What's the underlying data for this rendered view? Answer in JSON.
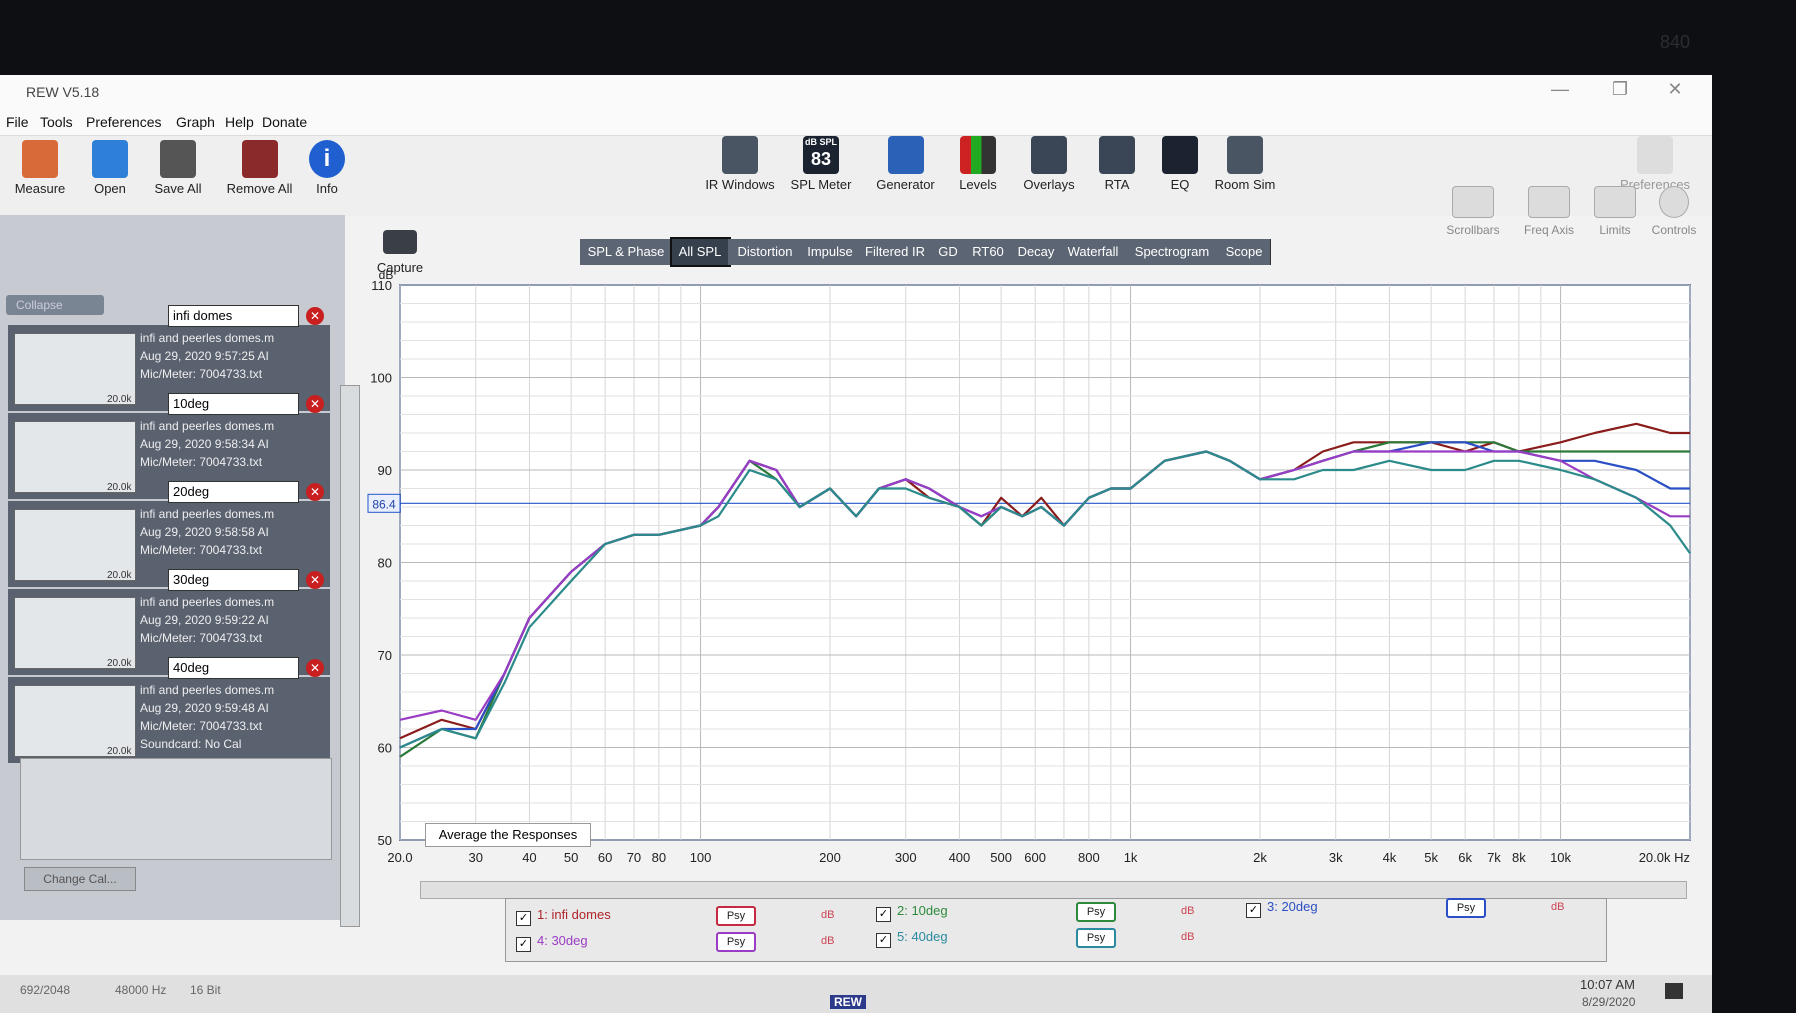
{
  "window": {
    "title": "REW V5.18",
    "controls": [
      "—",
      "❐",
      "✕"
    ]
  },
  "menu": [
    "File",
    "Tools",
    "Preferences",
    "Graph",
    "Help",
    "Donate"
  ],
  "toolbar_left": [
    {
      "label": "Measure",
      "icon": "microphone-icon"
    },
    {
      "label": "Open",
      "icon": "folder-icon"
    },
    {
      "label": "Save All",
      "icon": "save-icon"
    },
    {
      "label": "Remove All",
      "icon": "remove-icon"
    },
    {
      "label": "Info",
      "icon": "info-icon"
    }
  ],
  "toolbar_center": [
    {
      "label": "IR Windows",
      "icon": "ir-windows-icon"
    },
    {
      "label": "SPL Meter",
      "icon": "spl-meter-icon",
      "display": "83",
      "sub": "dB SPL"
    },
    {
      "label": "Generator",
      "icon": "generator-icon"
    },
    {
      "label": "Levels",
      "icon": "levels-icon"
    },
    {
      "label": "Overlays",
      "icon": "overlays-icon"
    },
    {
      "label": "RTA",
      "icon": "rta-icon"
    },
    {
      "label": "EQ",
      "icon": "eq-icon"
    },
    {
      "label": "Room Sim",
      "icon": "room-sim-icon"
    }
  ],
  "toolbar_right": {
    "preferences": "Preferences"
  },
  "graph_controls": [
    "Scrollbars",
    "Freq Axis",
    "Limits",
    "Controls"
  ],
  "collapse_label": "Collapse",
  "capture_label": "Capture",
  "measurements": [
    {
      "name": "infi domes",
      "file": "infi and peerles domes.m",
      "date": "Aug 29, 2020 9:57:25 AI",
      "mic": "Mic/Meter: 7004733.txt",
      "index": "1"
    },
    {
      "name": "10deg",
      "file": "infi and peerles domes.m",
      "date": "Aug 29, 2020 9:58:34 AI",
      "mic": "Mic/Meter: 7004733.txt",
      "index": "2"
    },
    {
      "name": "20deg",
      "file": "infi and peerles domes.m",
      "date": "Aug 29, 2020 9:58:58 AI",
      "mic": "Mic/Meter: 7004733.txt",
      "index": "3"
    },
    {
      "name": "30deg",
      "file": "infi and peerles domes.m",
      "date": "Aug 29, 2020 9:59:22 AI",
      "mic": "Mic/Meter: 7004733.txt",
      "index": "4"
    },
    {
      "name": "40deg",
      "file": "infi and peerles domes.m",
      "date": "Aug 29, 2020 9:59:48 AI",
      "mic": "Mic/Meter: 7004733.txt",
      "soundcard": "Soundcard: No Cal",
      "index": "5"
    }
  ],
  "thumb_tick": "20.0k",
  "change_cal": "Change Cal...",
  "tabs": [
    "SPL & Phase",
    "All SPL",
    "Distortion",
    "Impulse",
    "Filtered IR",
    "GD",
    "RT60",
    "Decay",
    "Waterfall",
    "Spectrogram",
    "Scope"
  ],
  "active_tab": "All SPL",
  "average_button": "Average the Responses",
  "chart_data": {
    "type": "line",
    "xscale": "log",
    "xlim": [
      20,
      20000
    ],
    "ylim": [
      50,
      110
    ],
    "ylabel": "dB",
    "xlabel": "Hz",
    "yticks": [
      50,
      60,
      70,
      80,
      90,
      100,
      110
    ],
    "xtick_labels": [
      {
        "v": 20,
        "t": "20.0"
      },
      {
        "v": 30,
        "t": "30"
      },
      {
        "v": 40,
        "t": "40"
      },
      {
        "v": 50,
        "t": "50"
      },
      {
        "v": 60,
        "t": "60"
      },
      {
        "v": 70,
        "t": "70"
      },
      {
        "v": 80,
        "t": "80"
      },
      {
        "v": 100,
        "t": "100"
      },
      {
        "v": 200,
        "t": "200"
      },
      {
        "v": 300,
        "t": "300"
      },
      {
        "v": 400,
        "t": "400"
      },
      {
        "v": 500,
        "t": "500"
      },
      {
        "v": 600,
        "t": "600"
      },
      {
        "v": 800,
        "t": "800"
      },
      {
        "v": 1000,
        "t": "1k"
      },
      {
        "v": 2000,
        "t": "2k"
      },
      {
        "v": 3000,
        "t": "3k"
      },
      {
        "v": 4000,
        "t": "4k"
      },
      {
        "v": 5000,
        "t": "5k"
      },
      {
        "v": 6000,
        "t": "6k"
      },
      {
        "v": 7000,
        "t": "7k"
      },
      {
        "v": 8000,
        "t": "8k"
      },
      {
        "v": 10000,
        "t": "10k"
      },
      {
        "v": 20000,
        "t": "20.0k Hz"
      }
    ],
    "reference_line": {
      "value": 86.4,
      "label": "86.4",
      "color": "#2255cc"
    },
    "grid": true,
    "x": [
      20,
      25,
      30,
      35,
      40,
      50,
      60,
      70,
      80,
      100,
      110,
      130,
      150,
      170,
      200,
      230,
      260,
      300,
      340,
      400,
      450,
      500,
      560,
      620,
      700,
      800,
      900,
      1000,
      1200,
      1500,
      1700,
      2000,
      2400,
      2800,
      3300,
      4000,
      5000,
      6000,
      7000,
      8000,
      10000,
      12000,
      15000,
      18000,
      20000
    ],
    "series": [
      {
        "name": "1: infi domes",
        "color": "#8a1c1c",
        "values": [
          61,
          63,
          62,
          68,
          74,
          79,
          82,
          83,
          83,
          84,
          86,
          91,
          90,
          86,
          88,
          85,
          88,
          89,
          87,
          86,
          84,
          87,
          85,
          87,
          84,
          87,
          88,
          88,
          91,
          92,
          91,
          89,
          90,
          92,
          93,
          93,
          93,
          92,
          93,
          92,
          93,
          94,
          95,
          94,
          94
        ]
      },
      {
        "name": "2: 10deg",
        "color": "#2c7a3a",
        "values": [
          59,
          62,
          61,
          68,
          74,
          79,
          82,
          83,
          83,
          84,
          86,
          91,
          89,
          86,
          88,
          85,
          88,
          89,
          88,
          86,
          84,
          86,
          85,
          86,
          84,
          87,
          88,
          88,
          91,
          92,
          91,
          89,
          90,
          91,
          92,
          93,
          93,
          93,
          93,
          92,
          92,
          92,
          92,
          92,
          92
        ]
      },
      {
        "name": "3: 20deg",
        "color": "#2b4fc4",
        "values": [
          60,
          62,
          62,
          68,
          74,
          79,
          82,
          83,
          83,
          84,
          86,
          91,
          90,
          86,
          88,
          85,
          88,
          89,
          88,
          86,
          85,
          86,
          85,
          86,
          84,
          87,
          88,
          88,
          91,
          92,
          91,
          89,
          90,
          91,
          92,
          92,
          93,
          93,
          92,
          92,
          91,
          91,
          90,
          88,
          88
        ]
      },
      {
        "name": "4: 30deg",
        "color": "#9a3cc4",
        "values": [
          63,
          64,
          63,
          68,
          74,
          79,
          82,
          83,
          83,
          84,
          86,
          91,
          90,
          86,
          88,
          85,
          88,
          89,
          88,
          86,
          85,
          86,
          85,
          86,
          84,
          87,
          88,
          88,
          91,
          92,
          91,
          89,
          90,
          91,
          92,
          92,
          92,
          92,
          92,
          92,
          91,
          89,
          87,
          85,
          85
        ]
      },
      {
        "name": "5: 40deg",
        "color": "#2b8a8a",
        "values": [
          60,
          62,
          61,
          67,
          73,
          78,
          82,
          83,
          83,
          84,
          85,
          90,
          89,
          86,
          88,
          85,
          88,
          88,
          87,
          86,
          84,
          86,
          85,
          86,
          84,
          87,
          88,
          88,
          91,
          92,
          91,
          89,
          89,
          90,
          90,
          91,
          90,
          90,
          91,
          91,
          90,
          89,
          87,
          84,
          81
        ]
      }
    ]
  },
  "legend": [
    {
      "label": "1: infi domes",
      "color": "#b0232b",
      "psy_color": "#c42a44",
      "db": "dB"
    },
    {
      "label": "2: 10deg",
      "color": "#2d8a3a",
      "psy_color": "#2d8a3a",
      "db": "dB"
    },
    {
      "label": "3: 20deg",
      "color": "#2b4fc4",
      "psy_color": "#2b4fc4",
      "db": "dB"
    },
    {
      "label": "4: 30deg",
      "color": "#9a3cc4",
      "psy_color": "#9a3cc4",
      "db": "dB"
    },
    {
      "label": "5: 40deg",
      "color": "#2b8aa0",
      "psy_color": "#2b8aa0",
      "db": "dB"
    }
  ],
  "psy_label": "Psy",
  "status": {
    "mem": "692/2048",
    "rate": "48000 Hz",
    "bits": "16 Bit"
  },
  "taskbar": {
    "time": "10:07 AM",
    "date": "8/29/2020",
    "app": "REW"
  },
  "monitor_brand": "840"
}
